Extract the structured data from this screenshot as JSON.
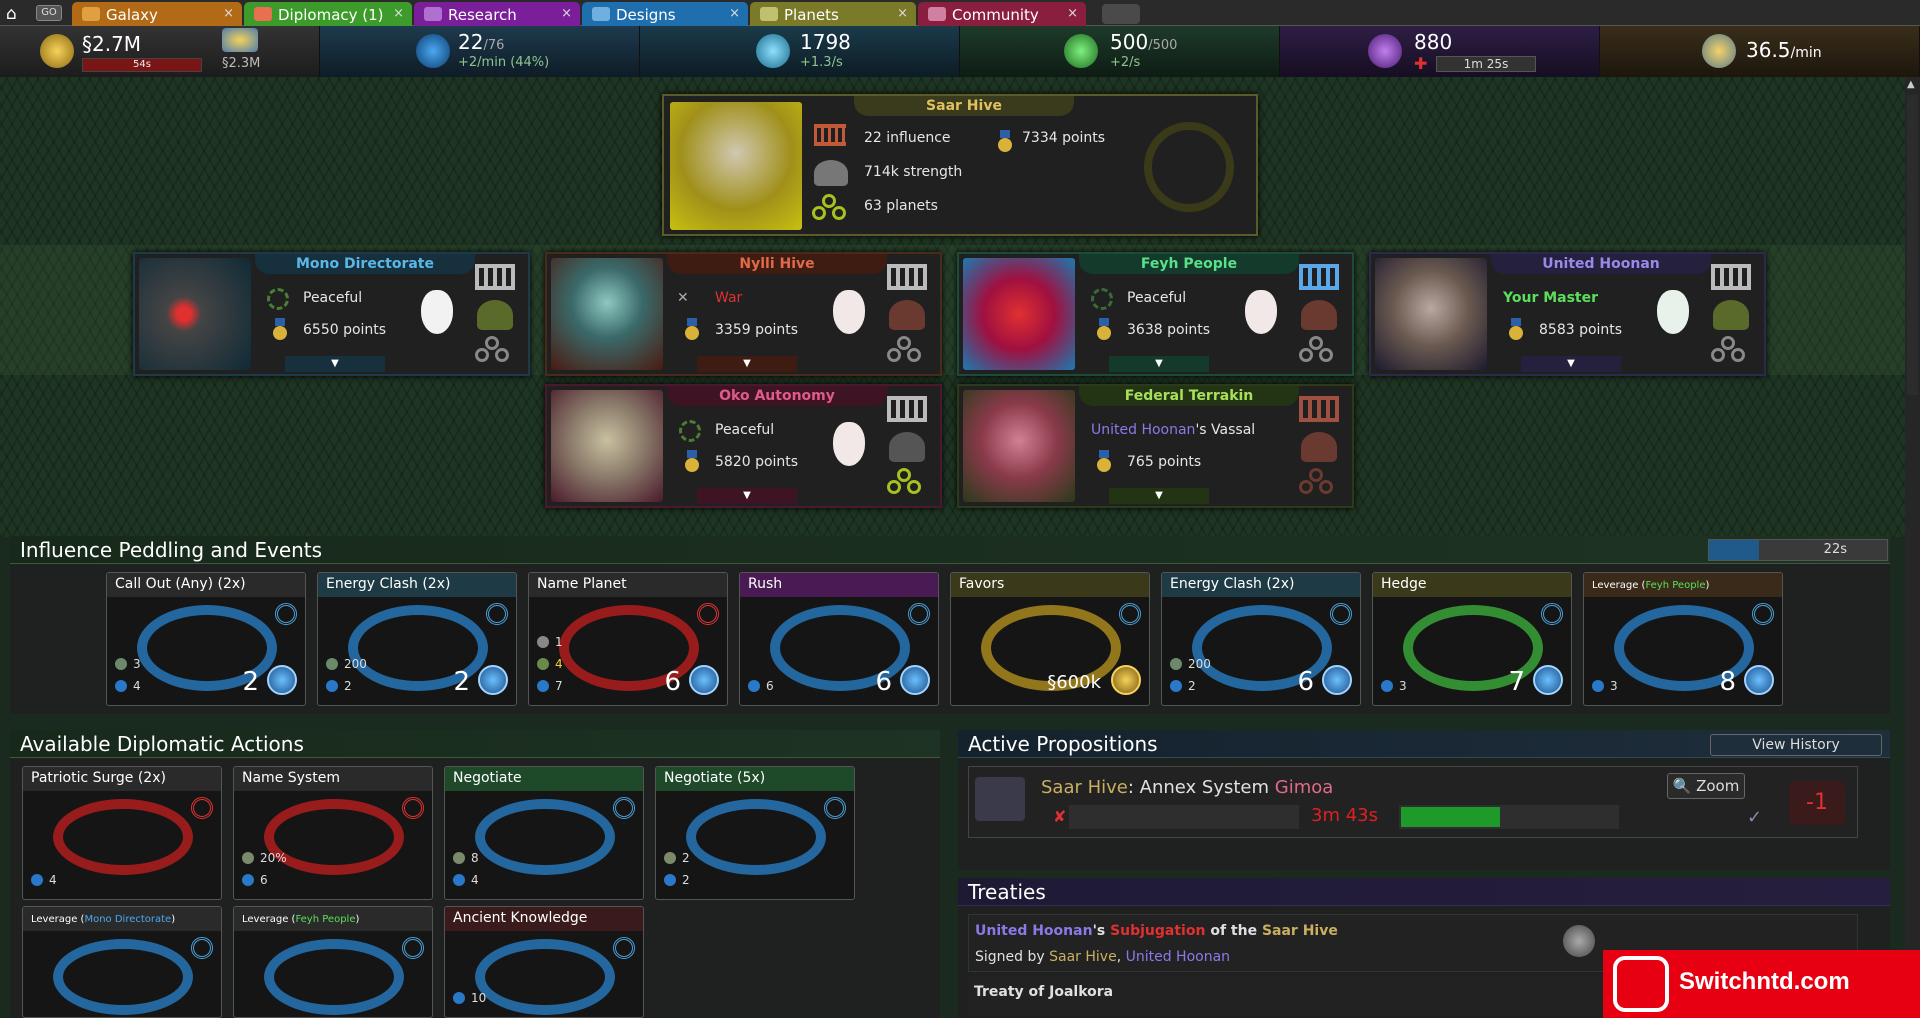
{
  "tabs": {
    "go": "GO",
    "items": [
      {
        "label": "Galaxy",
        "color": "#b26a16",
        "icon": "galaxy-icon"
      },
      {
        "label": "Diplomacy (1)",
        "color": "#3c9b2a",
        "icon": "handshake-icon"
      },
      {
        "label": "Research",
        "color": "#7a1e9a",
        "icon": "flask-icon"
      },
      {
        "label": "Designs",
        "color": "#1f6fae",
        "icon": "ship-design-icon"
      },
      {
        "label": "Planets",
        "color": "#7a7a28",
        "icon": "planet-icon"
      },
      {
        "label": "Community",
        "color": "#8a1e3e",
        "icon": "community-icon"
      }
    ],
    "close": "×"
  },
  "resources": {
    "credits": {
      "value": "§2.7M",
      "timer": "54s",
      "secondary": "§2.3M",
      "icon": "credits-icon"
    },
    "influence": {
      "value": "22",
      "max": "/76",
      "rate": "+2/min (44%)",
      "icon": "influence-icon"
    },
    "energy": {
      "value": "1798",
      "rate": "+1.3/s",
      "icon": "energy-icon"
    },
    "hydrogen": {
      "value": "500",
      "max": "/500",
      "rate": "+2/s",
      "icon": "population-icon"
    },
    "research": {
      "value": "880",
      "timer": "1m 25s",
      "icon": "research-icon"
    },
    "culture": {
      "value": "36.5",
      "unit": "/min",
      "icon": "shield-icon"
    }
  },
  "empires": {
    "saar": {
      "name": "Saar Hive",
      "influence": "22 influence",
      "points": "7334 points",
      "strength": "714k strength",
      "planets": "63 planets"
    },
    "mono": {
      "name": "Mono Directorate",
      "status": "Peaceful",
      "points": "6550 points"
    },
    "nylli": {
      "name": "Nylli Hive",
      "status": "War",
      "points": "3359 points"
    },
    "feyh": {
      "name": "Feyh People",
      "status": "Peaceful",
      "points": "3638 points"
    },
    "united": {
      "name": "United Hoonan",
      "status": "Your Master",
      "points": "8583 points"
    },
    "oko": {
      "name": "Oko Autonomy",
      "status": "Peaceful",
      "points": "5820 points"
    },
    "federal": {
      "name": "Federal Terrakin",
      "master": "United Hoonan",
      "suffix": "'s Vassal",
      "points": "765 points"
    },
    "expand": "▼"
  },
  "influence_section": {
    "title": "Influence Peddling and Events",
    "timer": "22s",
    "timer_progress": 0.28,
    "cards": [
      {
        "title": "Call Out (Any) (2x)",
        "a": "3",
        "b": "4",
        "cost": "2",
        "color": "#2a2a2a"
      },
      {
        "title": "Energy Clash (2x)",
        "a": "200",
        "b": "2",
        "cost": "2",
        "color": "#1e3a44"
      },
      {
        "title": "Name Planet",
        "a": "1",
        "b": "4",
        "c": "7",
        "cost": "6",
        "color": "#2a2a2a"
      },
      {
        "title": "Rush",
        "a": "6",
        "cost": "6",
        "color": "#4a1a55"
      },
      {
        "title": "Favors",
        "cost": "§600k",
        "color": "#3a3a1a"
      },
      {
        "title": "Energy Clash (2x)",
        "a": "200",
        "b": "2",
        "cost": "6",
        "color": "#1e3a44"
      },
      {
        "title": "Hedge",
        "a": "3",
        "cost": "7",
        "color": "#3a3a1a"
      },
      {
        "title": "Leverage",
        "target": "Feyh People",
        "a": "3",
        "cost": "8",
        "color": "#3a2a1a"
      }
    ]
  },
  "diplomatic_section": {
    "title": "Available Diplomatic Actions",
    "cards": [
      {
        "title": "Patriotic Surge (2x)",
        "a": "4",
        "color": "#2a2a2a"
      },
      {
        "title": "Name System",
        "a": "20%",
        "b": "6",
        "color": "#2a2a2a"
      },
      {
        "title": "Negotiate",
        "a": "8",
        "b": "4",
        "color": "#1e4a2a"
      },
      {
        "title": "Negotiate (5x)",
        "a": "2",
        "b": "2",
        "color": "#1e4a2a"
      },
      {
        "title": "Leverage",
        "target": "Mono Directorate",
        "color": "#2a2a2a"
      },
      {
        "title": "Leverage",
        "target": "Feyh People",
        "color": "#2a2a2a"
      },
      {
        "title": "Ancient Knowledge",
        "a": "10",
        "color": "#3a1a1a"
      }
    ]
  },
  "propositions": {
    "title": "Active Propositions",
    "view_history": "View History",
    "item": {
      "empire": "Saar Hive",
      "action": ": Annex System ",
      "system": "Gimoa",
      "timer": "3m 43s",
      "zoom": "Zoom",
      "score": "-1",
      "progress": 0.45
    }
  },
  "treaties": {
    "title": "Treaties",
    "items": [
      {
        "party1": "United Hoonan",
        "possessive": "'s ",
        "type": "Subjugation",
        "of": " of the ",
        "party2": "Saar Hive",
        "signed_label": "Signed by ",
        "signer1": "Saar Hive",
        "sep": ", ",
        "signer2": "United Hoonan"
      },
      {
        "title": "Treaty of Joalkora"
      }
    ]
  },
  "watermark": {
    "text": "Switchntd.com"
  }
}
